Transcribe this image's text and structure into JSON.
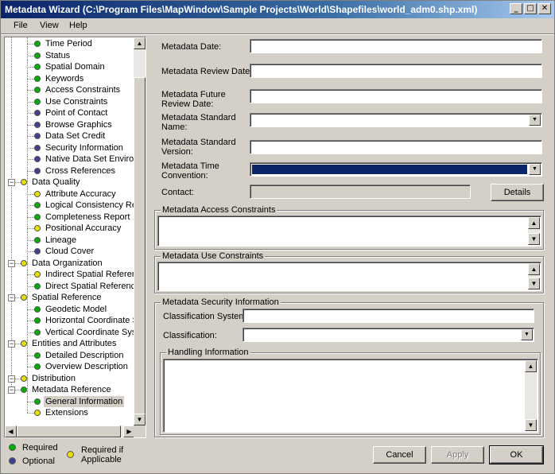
{
  "window": {
    "title": "Metadata Wizard (C:\\Program Files\\MapWindow\\Sample Projects\\World\\Shapefiles\\world_adm0.shp.xml)",
    "minimize": "_",
    "maximize": "□",
    "close": "✕"
  },
  "menu": [
    "File",
    "View",
    "Help"
  ],
  "colors": {
    "required": "#00b000",
    "optional": "#404090",
    "applicable": "#e8e000",
    "selection": "#0a246a"
  },
  "tree": [
    {
      "label": "Time Period",
      "status": "required"
    },
    {
      "label": "Status",
      "status": "required"
    },
    {
      "label": "Spatial Domain",
      "status": "required"
    },
    {
      "label": "Keywords",
      "status": "required"
    },
    {
      "label": "Access Constraints",
      "status": "required"
    },
    {
      "label": "Use Constraints",
      "status": "required"
    },
    {
      "label": "Point of Contact",
      "status": "optional"
    },
    {
      "label": "Browse Graphics",
      "status": "optional"
    },
    {
      "label": "Data Set Credit",
      "status": "optional"
    },
    {
      "label": "Security Information",
      "status": "optional"
    },
    {
      "label": "Native Data Set Environme",
      "status": "optional"
    },
    {
      "label": "Cross References",
      "status": "optional"
    },
    {
      "label": "Data Quality",
      "status": "applicable"
    },
    {
      "label": "Attribute Accuracy",
      "status": "applicable"
    },
    {
      "label": "Logical Consistency Repor",
      "status": "required"
    },
    {
      "label": "Completeness Report",
      "status": "required"
    },
    {
      "label": "Positional Accuracy",
      "status": "applicable"
    },
    {
      "label": "Lineage",
      "status": "required"
    },
    {
      "label": "Cloud Cover",
      "status": "optional"
    },
    {
      "label": "Data Organization",
      "status": "applicable"
    },
    {
      "label": "Indirect Spatial Reference",
      "status": "applicable"
    },
    {
      "label": "Direct Spatial Reference",
      "status": "required"
    },
    {
      "label": "Spatial Reference",
      "status": "applicable"
    },
    {
      "label": "Geodetic Model",
      "status": "required"
    },
    {
      "label": "Horizontal Coordinate Syst",
      "status": "required"
    },
    {
      "label": "Vertical Coordinate System",
      "status": "required"
    },
    {
      "label": "Entities and Attributes",
      "status": "applicable"
    },
    {
      "label": "Detailed Description",
      "status": "required"
    },
    {
      "label": "Overview Description",
      "status": "required"
    },
    {
      "label": "Distribution",
      "status": "applicable"
    },
    {
      "label": "Metadata Reference",
      "status": "required"
    },
    {
      "label": "General Information",
      "status": "required",
      "selected": true
    },
    {
      "label": "Extensions",
      "status": "applicable"
    }
  ],
  "legend": {
    "required": "Required",
    "optional": "Optional",
    "applicable_line1": "Required if",
    "applicable_line2": "Applicable"
  },
  "form": {
    "metadata_date": {
      "label": "Metadata Date:",
      "value": ""
    },
    "review_date": {
      "label": "Metadata Review Date:",
      "value": ""
    },
    "future_review_line1": "Metadata Future",
    "future_review_line2": "Review Date:",
    "standard_name_line1": "Metadata Standard",
    "standard_name_line2": "Name:",
    "standard_version_line1": "Metadata Standard",
    "standard_version_line2": "Version:",
    "time_convention_line1": "Metadata Time",
    "time_convention_line2": "Convention:",
    "contact_label": "Contact:",
    "details_button": "Details",
    "access_constraints_title": "Metadata Access Constraints",
    "use_constraints_title": "Metadata Use Constraints",
    "security_title": "Metadata Security Information",
    "classification_system_label": "Classification System:",
    "classification_label": "Classification:",
    "handling_title": "Handling Information"
  },
  "buttons": {
    "cancel": "Cancel",
    "apply": "Apply",
    "ok": "OK"
  }
}
